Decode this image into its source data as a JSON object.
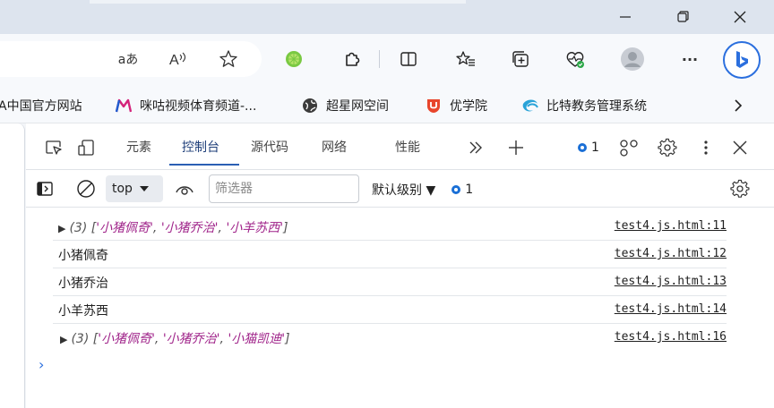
{
  "window": {
    "minimize_label": "—",
    "close_label": "✕"
  },
  "toolbar": {
    "icons": [
      "read-aloud-icon",
      "text-size-icon",
      "favorite-star-icon",
      "extension-lime-icon",
      "extensions-puzzle-icon",
      "split-screen-icon",
      "favorites-list-icon",
      "collections-icon",
      "browser-essentials-icon",
      "profile-avatar-icon",
      "more-icon",
      "bing-copilot-icon"
    ],
    "read_aloud_label": "aあ",
    "text_label": "A",
    "more_label": "···"
  },
  "favorites": [
    {
      "label": "A中国官方网站",
      "icon": "page-icon"
    },
    {
      "label": "咪咕视频体育频道-...",
      "icon": "migu-logo-icon"
    },
    {
      "label": "超星网空间",
      "icon": "globe-icon"
    },
    {
      "label": "优学院",
      "icon": "youxueyuan-logo-icon"
    },
    {
      "label": "比特教务管理系统",
      "icon": "bit-logo-icon"
    }
  ],
  "devtools": {
    "tabs": [
      {
        "label": "元素",
        "active": false
      },
      {
        "label": "控制台",
        "active": true
      },
      {
        "label": "源代码",
        "active": false
      },
      {
        "label": "网络",
        "active": false
      },
      {
        "label": "性能",
        "active": false
      }
    ],
    "issues_count": "1",
    "filterbar": {
      "context": "top",
      "filter_placeholder": "筛选器",
      "levels_label": "默认级别 ▼",
      "levels_issues": "1"
    }
  },
  "console": {
    "rows": [
      {
        "type": "array",
        "prefix": "(3) [",
        "items": [
          "'小猪佩奇'",
          "'小猪乔治'",
          "'小羊苏西'"
        ],
        "suffix": "]",
        "source": "test4.js.html:11"
      },
      {
        "type": "text",
        "text": "小猪佩奇",
        "source": "test4.js.html:12"
      },
      {
        "type": "text",
        "text": "小猪乔治",
        "source": "test4.js.html:13"
      },
      {
        "type": "text",
        "text": "小羊苏西",
        "source": "test4.js.html:14"
      },
      {
        "type": "array",
        "prefix": "(3) [",
        "items": [
          "'小猪佩奇'",
          "'小猪乔治'",
          "'小猫凯迪'"
        ],
        "suffix": "]",
        "source": "test4.js.html:16"
      }
    ],
    "prompt": "›"
  },
  "colors": {
    "accent": "#2b5fb4",
    "string": "#a0248a",
    "bing": "#2b6fde"
  }
}
